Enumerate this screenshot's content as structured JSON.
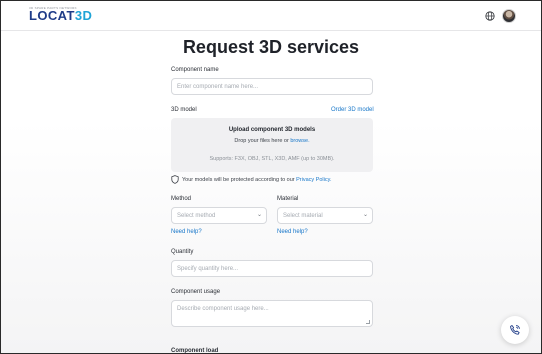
{
  "header": {
    "logo_tagline": "3D Spare Parts Network",
    "logo_text_main": "LOCAT",
    "logo_text_accent": "3D",
    "globe_icon": "globe-icon",
    "avatar_icon": "user-avatar"
  },
  "page": {
    "title": "Request 3D services"
  },
  "form": {
    "component_name": {
      "label": "Component name",
      "placeholder": "Enter component name here..."
    },
    "model": {
      "label": "3D model",
      "order_link": "Order 3D model",
      "upload_title": "Upload component 3D models",
      "upload_drop_text": "Drop your files here or ",
      "upload_browse": "browse.",
      "upload_supports": "Supports: F3X, OBJ, STL, X3D, AMF (up to 30MB)."
    },
    "privacy": {
      "text": "Your models will be protected according to our ",
      "link": "Privacy Policy."
    },
    "method": {
      "label": "Method",
      "placeholder": "Select method",
      "help": "Need help?"
    },
    "material": {
      "label": "Material",
      "placeholder": "Select material",
      "help": "Need help?"
    },
    "quantity": {
      "label": "Quantity",
      "placeholder": "Specify quantity here..."
    },
    "usage": {
      "label": "Component usage",
      "placeholder": "Describe component usage here..."
    },
    "next_section_label": "Component load"
  },
  "floating": {
    "call_icon": "phone-call-icon"
  },
  "colors": {
    "brand_blue": "#1f3c88",
    "accent_cyan": "#1fa4d6",
    "link": "#1877c9"
  }
}
